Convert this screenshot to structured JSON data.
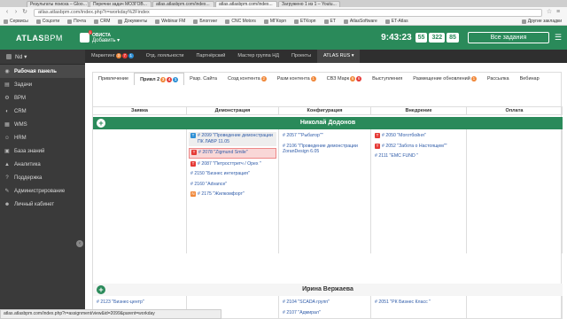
{
  "browser": {
    "tabs": [
      "Результаты поиска – Gloo...",
      "Перечни задач МОЗГОВ...",
      "atlas.atlasbpm.com/index...",
      "atlas.atlasbpm.com/index...",
      "Загружено 1 из 1 – Youtu..."
    ],
    "url": "atlas.atlasbpm.com/index.php?r=workday%2Findex",
    "bookmarks": [
      "Сервисы",
      "Соцсети",
      "Почта",
      "CRM",
      "Документы",
      "Webinar FM",
      "Блоггинг",
      "CNC Motors",
      "МГКорп",
      "ETКорп",
      "ET",
      "AtlasSoftware",
      "ET-Atlas"
    ],
    "bookmarks_right": "Другие закладки",
    "status_url": "atlas.atlasbpm.com/index.php?r=assignment/view&id=2099&parent=workday"
  },
  "header": {
    "logo_bold": "ATLAS",
    "logo_rest": "BPM",
    "company_badge": "1",
    "company_name": "ОВИСТА",
    "company_add": "Добавить ▾",
    "clock": "9:43:23",
    "counters": [
      "55",
      "322",
      "85"
    ],
    "all_tasks_button": "Все задания",
    "menu_icon": "☰"
  },
  "sidebar": {
    "user": "Nd ▾",
    "items": [
      {
        "icon": "◉",
        "label": "Рабочая панель",
        "active": true
      },
      {
        "icon": "▤",
        "label": "Задачи"
      },
      {
        "icon": "⚙",
        "label": "BPM"
      },
      {
        "icon": "◐",
        "label": "CRM"
      },
      {
        "icon": "▦",
        "label": "WMS"
      },
      {
        "icon": "☺",
        "label": "HRM"
      },
      {
        "icon": "▣",
        "label": "База знаний"
      },
      {
        "icon": "▲",
        "label": "Аналитика"
      },
      {
        "icon": "?",
        "label": "Поддержка"
      },
      {
        "icon": "✎",
        "label": "Администрирование"
      },
      {
        "icon": "☻",
        "label": "Личный кабинет"
      }
    ],
    "collapse_icon": "‹"
  },
  "subnav": [
    {
      "label": "Маркетинг",
      "badges": [
        {
          "v": "3",
          "c": "orange"
        },
        {
          "v": "7",
          "c": "red"
        },
        {
          "v": "1",
          "c": "blue"
        }
      ]
    },
    {
      "label": "Отд. лояльности"
    },
    {
      "label": "Партнёрский"
    },
    {
      "label": "Мастер группа НД"
    },
    {
      "label": "Проекты"
    },
    {
      "label": "ATLAS RUS ▾",
      "active": true
    }
  ],
  "content_tabs": [
    {
      "label": "Привлечение"
    },
    {
      "label": "Привл 2",
      "active": true,
      "badges": [
        {
          "v": "3",
          "c": "orange"
        },
        {
          "v": "4",
          "c": "red"
        },
        {
          "v": "1",
          "c": "blue"
        }
      ]
    },
    {
      "label": "Разр. Сайта"
    },
    {
      "label": "Созд контента",
      "badges": [
        {
          "v": "2",
          "c": "orange"
        }
      ]
    },
    {
      "label": "Разм контента",
      "badges": [
        {
          "v": "1",
          "c": "orange"
        }
      ]
    },
    {
      "label": "СВЗ Марк",
      "badges": [
        {
          "v": "6",
          "c": "orange"
        },
        {
          "v": "6",
          "c": "red"
        }
      ]
    },
    {
      "label": "Выступления"
    },
    {
      "label": "Размещение обновлений",
      "badges": [
        {
          "v": "1",
          "c": "orange"
        }
      ]
    },
    {
      "label": "Рассылка"
    },
    {
      "label": "Вебинар"
    }
  ],
  "columns": [
    "Заявка",
    "Демонстрация",
    "Конфигурация",
    "Внедрение",
    "Оплата"
  ],
  "groups": [
    {
      "person": "Николай Додонов",
      "style": "green",
      "columns": [
        [],
        [
          {
            "tag": "T",
            "tc": "blue",
            "text": "# 2099 \"Проведение демонстрации ПК ЛАВР 11.05",
            "hl": "hl"
          },
          {
            "tag": "T",
            "tc": "red",
            "text": "# 2078 \"Zigmund Smile\"",
            "hl": "red"
          },
          {
            "tag": "T",
            "tc": "red",
            "text": "# 2087 \"Петросттретч / Opex \""
          },
          {
            "text": "# 2150 \"Бизнес интеграция\""
          },
          {
            "text": "# 2160 \"Advance\""
          },
          {
            "tag": "N",
            "tc": "orange",
            "text": "# 2175 \"Жилкомфорт\""
          }
        ],
        [
          {
            "text": "# 2057 \"\"Рыбатор\"\""
          },
          {
            "text": "# 2106 \"Проведение демонстрации ZoranDesign 6.05"
          }
        ],
        [
          {
            "tag": "T",
            "tc": "red",
            "text": "# 2050 \"Моготбойня\""
          },
          {
            "tag": "T",
            "tc": "red",
            "text": "# 2052 \"Забота о Настоящем\"\""
          },
          {
            "text": "# 2111 \"EMC FUND \""
          }
        ],
        []
      ]
    },
    {
      "person": "Ирина Вержаева",
      "style": "light",
      "columns": [
        [
          {
            "text": "# 2123 \"Бизнес-центр\""
          },
          {
            "tag": "T",
            "tc": "red",
            "text": "# 2058 \"Безкредитофф\""
          }
        ],
        [],
        [
          {
            "text": "# 2104 \"SCADA групп\""
          },
          {
            "text": "# 2107 \"Адмирал\""
          }
        ],
        [
          {
            "text": "# 2051 \"РК Бизнес Класс \""
          }
        ],
        []
      ]
    }
  ]
}
